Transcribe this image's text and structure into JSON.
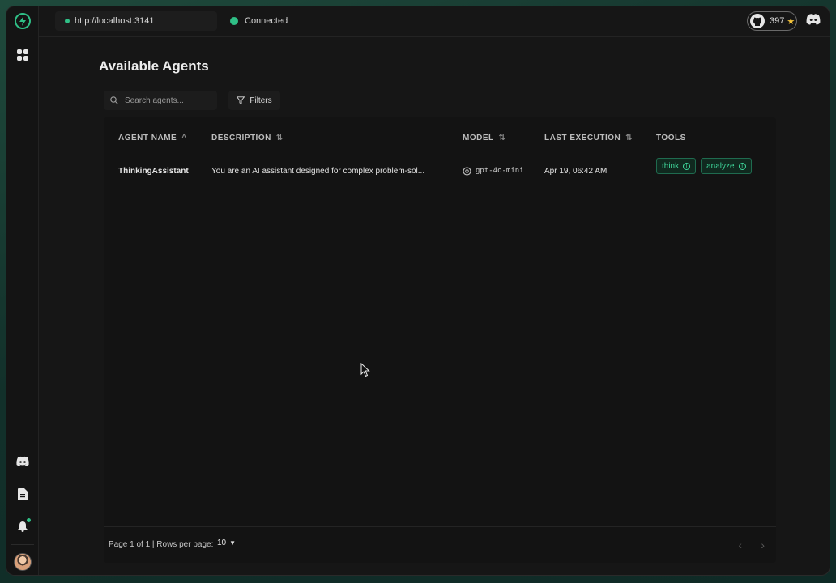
{
  "topbar": {
    "server_url": "http://localhost:3141",
    "connection_status": "Connected",
    "github_stars": "397"
  },
  "page": {
    "title": "Available Agents"
  },
  "search": {
    "placeholder": "Search agents..."
  },
  "filters": {
    "label": "Filters"
  },
  "table": {
    "columns": [
      {
        "label": "AGENT NAME",
        "sort": "asc"
      },
      {
        "label": "DESCRIPTION",
        "sort": "none"
      },
      {
        "label": "MODEL",
        "sort": "none"
      },
      {
        "label": "LAST EXECUTION",
        "sort": "none"
      },
      {
        "label": "TOOLS",
        "sort": ""
      }
    ],
    "rows": [
      {
        "name": "ThinkingAssistant",
        "description": "You are an AI assistant designed for complex problem-sol...",
        "model": "gpt-4o-mini",
        "last_execution": "Apr 19, 06:42 AM",
        "tools": [
          "think",
          "analyze"
        ]
      }
    ]
  },
  "pagination": {
    "page_info": "Page 1 of 1 | Rows per page:",
    "rows_per_page": "10"
  },
  "colors": {
    "accent": "#2fbf86",
    "star": "#f5c43a"
  },
  "icons": {
    "sidebar": [
      "logo-icon",
      "agents-grid-icon",
      "discord-icon",
      "docs-icon",
      "bell-icon",
      "avatar"
    ],
    "topbar": [
      "github-icon",
      "star-icon",
      "discord-icon"
    ]
  }
}
